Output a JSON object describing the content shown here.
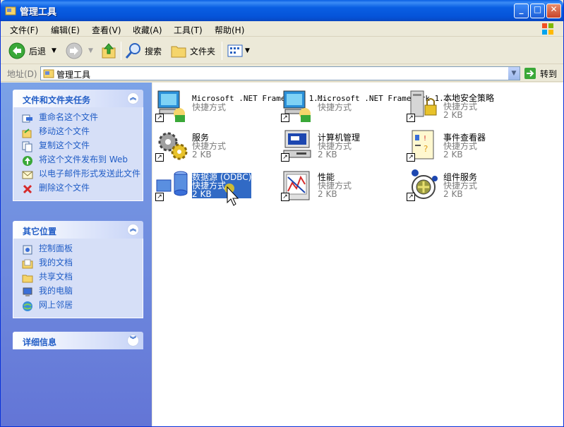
{
  "window": {
    "title": "管理工具"
  },
  "menu": [
    "文件(F)",
    "编辑(E)",
    "查看(V)",
    "收藏(A)",
    "工具(T)",
    "帮助(H)"
  ],
  "toolbar": {
    "back": "后退",
    "search": "搜索",
    "folders": "文件夹"
  },
  "address": {
    "label": "地址(D)",
    "value": "管理工具",
    "go": "转到"
  },
  "tasks_panel": {
    "title": "文件和文件夹任务",
    "items": [
      "重命名这个文件",
      "移动这个文件",
      "复制这个文件",
      "将这个文件发布到 Web",
      "以电子邮件形式发送此文件",
      "删除这个文件"
    ]
  },
  "places_panel": {
    "title": "其它位置",
    "items": [
      "控制面板",
      "我的文档",
      "共享文档",
      "我的电脑",
      "网上邻居"
    ]
  },
  "details_panel": {
    "title": "详细信息"
  },
  "files": [
    {
      "name": "Microsoft .NET Framework 1....",
      "type": "快捷方式",
      "size": "",
      "icon": "net-framework-icon",
      "selected": false
    },
    {
      "name": "Microsoft .NET Framework 1....",
      "type": "快捷方式",
      "size": "",
      "icon": "net-framework-icon",
      "selected": false
    },
    {
      "name": "本地安全策略",
      "type": "快捷方式",
      "size": "2 KB",
      "icon": "security-policy-icon",
      "selected": false
    },
    {
      "name": "服务",
      "type": "快捷方式",
      "size": "2 KB",
      "icon": "services-icon",
      "selected": false
    },
    {
      "name": "计算机管理",
      "type": "快捷方式",
      "size": "2 KB",
      "icon": "computer-management-icon",
      "selected": false
    },
    {
      "name": "事件查看器",
      "type": "快捷方式",
      "size": "2 KB",
      "icon": "event-viewer-icon",
      "selected": false
    },
    {
      "name": "数据源 (ODBC)",
      "type": "快捷方式",
      "size": "2 KB",
      "icon": "odbc-icon",
      "selected": true
    },
    {
      "name": "性能",
      "type": "快捷方式",
      "size": "2 KB",
      "icon": "performance-icon",
      "selected": false
    },
    {
      "name": "组件服务",
      "type": "快捷方式",
      "size": "2 KB",
      "icon": "component-services-icon",
      "selected": false
    }
  ]
}
